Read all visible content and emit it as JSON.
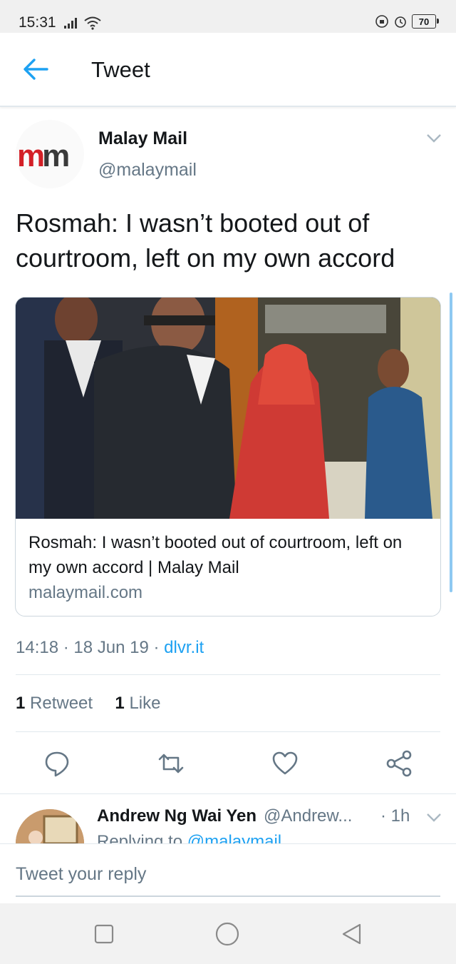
{
  "status_bar": {
    "time": "15:31",
    "battery": "70"
  },
  "header": {
    "title": "Tweet"
  },
  "tweet": {
    "author_name": "Malay Mail",
    "author_handle": "@malaymail",
    "avatar_logo_a": "m",
    "avatar_logo_b": "m",
    "text": "Rosmah: I wasn’t booted out of courtroom, left on my own accord",
    "card": {
      "title": "Rosmah: I wasn’t booted out of courtroom, left on my own accord | Malay Mail",
      "domain": "malaymail.com"
    },
    "time": "14:18",
    "date": "18 Jun 19",
    "source": "dlvr.it",
    "retweet_count": "1",
    "retweet_label": "Retweet",
    "like_count": "1",
    "like_label": "Like"
  },
  "reply": {
    "name": "Andrew Ng Wai Yen",
    "handle": "@Andrew...",
    "time": "· 1h",
    "replying_prefix": "Replying to",
    "replying_to": "@malaymail"
  },
  "compose": {
    "placeholder": "Tweet your reply"
  },
  "icons": [
    "back-arrow-icon",
    "reply-icon",
    "retweet-icon",
    "like-icon",
    "share-icon",
    "chevron-down-icon"
  ],
  "colors": {
    "accent": "#1da1f2",
    "muted": "#657786"
  }
}
